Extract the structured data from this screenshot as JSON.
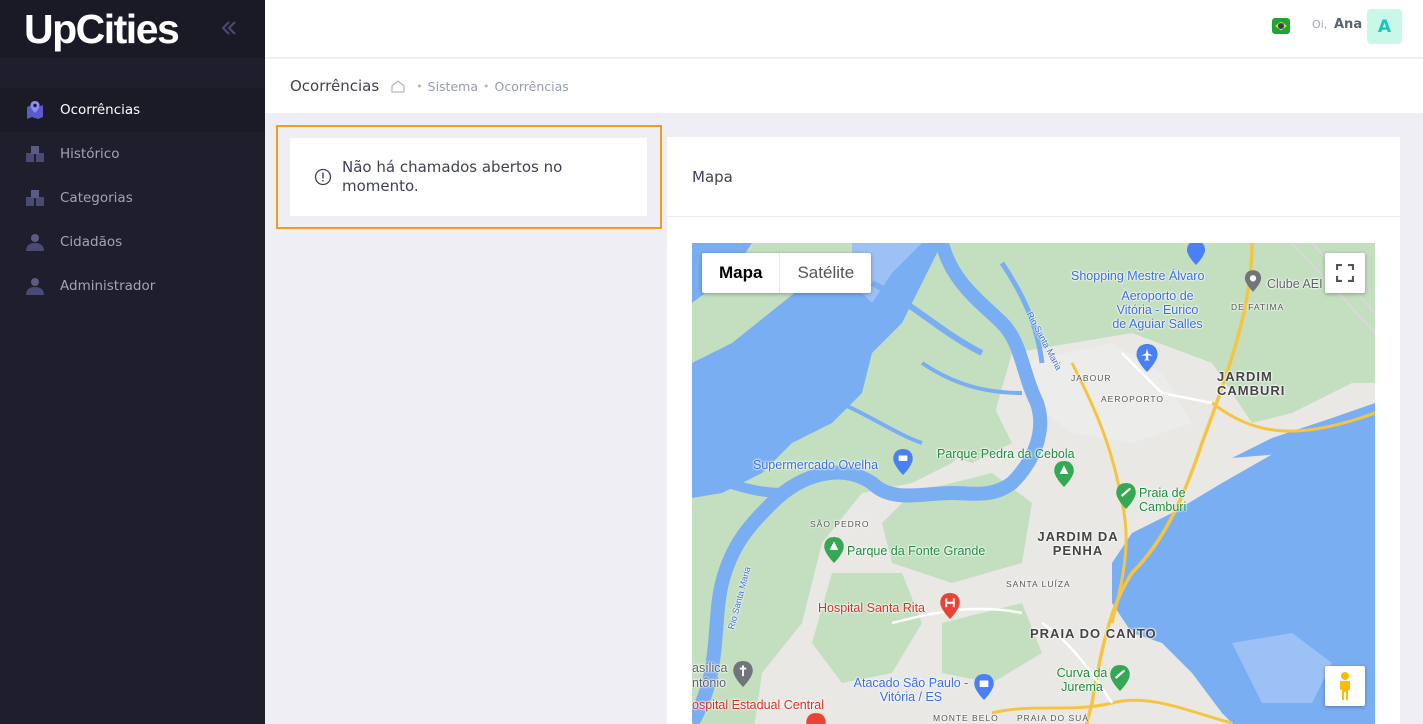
{
  "app": {
    "logo_text": "UpCities"
  },
  "sidebar": {
    "items": [
      {
        "label": "Ocorrências",
        "active": true,
        "icon": "map-marker-icon"
      },
      {
        "label": "Histórico",
        "active": false,
        "icon": "layers-icon"
      },
      {
        "label": "Categorias",
        "active": false,
        "icon": "layers-icon"
      },
      {
        "label": "Cidadãos",
        "active": false,
        "icon": "user-icon"
      },
      {
        "label": "Administrador",
        "active": false,
        "icon": "user-icon"
      }
    ]
  },
  "header": {
    "greeting": "Oi,",
    "user_name": "Ana",
    "avatar_letter": "A",
    "language_flag": "brazil-flag-icon"
  },
  "subheader": {
    "title": "Ocorrências",
    "breadcrumbs": [
      "Sistema",
      "Ocorrências"
    ]
  },
  "alert": {
    "message": "Não há chamados abertos no momento."
  },
  "map_card": {
    "title": "Mapa",
    "map_type_options": [
      "Mapa",
      "Satélite"
    ],
    "selected_map_type": "Mapa",
    "labels": {
      "shopping": "Shopping Mestre Álvaro",
      "clube": "Clube AEI",
      "de_fatima": "DE FATIMA",
      "aeroporto_name": "Aeroporto de Vitória - Eurico de Aguiar Salles",
      "rio_santa_maria_1": "Rio Santa Maria",
      "rio_santa_maria_2": "Rio Santa Maria",
      "jabour": "JABOUR",
      "aeroporto": "AEROPORTO",
      "jardim_camburi": "JARDIM CAMBURI",
      "parque_pedra": "Parque Pedra da Cebola",
      "supermercado": "Supermercado Ovelha",
      "praia_camburi": "Praia de Camburi",
      "sao_pedro": "SÃO PEDRO",
      "jardim_penha": "JARDIM DA PENHA",
      "parque_fonte": "Parque da Fonte Grande",
      "santa_luiza": "SANTA LUÍZA",
      "hospital_santa_rita": "Hospital Santa Rita",
      "praia_canto": "PRAIA DO CANTO",
      "basilica": "asílica",
      "antonio": "ntônio",
      "curva_jurema": "Curva da Jurema",
      "atacado": "Atacado São Paulo - Vitória / ES",
      "hospital_estadual": "ospital Estadual Central",
      "monte_belo": "MONTE BELO",
      "praia_sua": "PRAIA DO SUÁ"
    }
  },
  "colors": {
    "sidebar_bg": "#1e1e2d",
    "accent_icon": "#7e7ef0",
    "alert_outline": "#f39c1a",
    "avatar_bg": "#c9f7e8",
    "avatar_text": "#1bc5bd",
    "water": "#7aaef2",
    "park": "#c8e2c4"
  }
}
